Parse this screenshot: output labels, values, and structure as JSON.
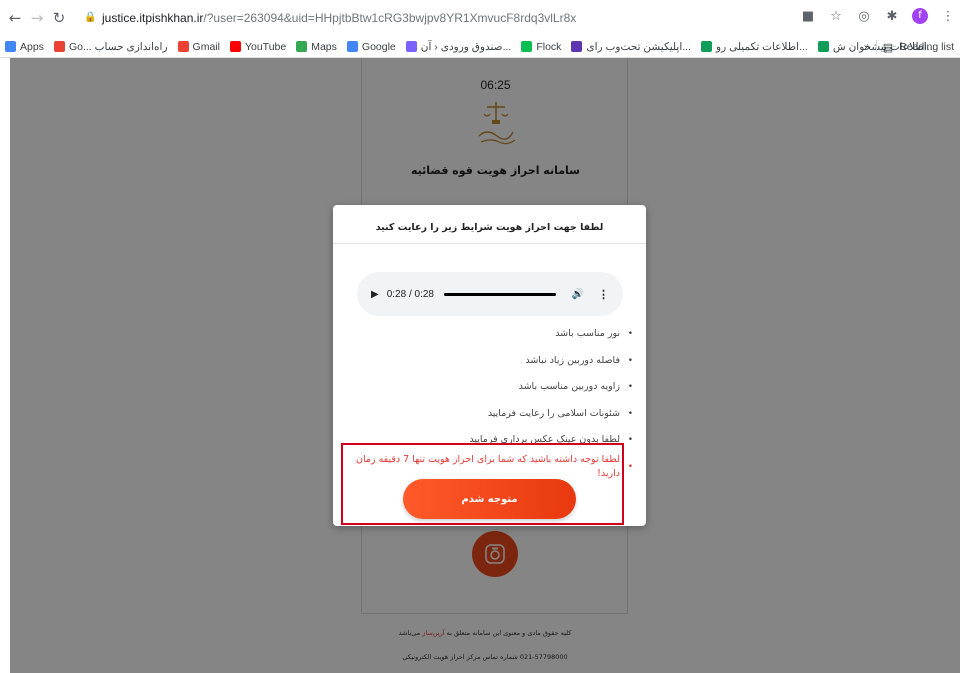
{
  "browser": {
    "url_host": "justice.itpishkhan.ir",
    "url_path": "/?user=263094&uid=HHpjtbBtw1cRG3bwjpv8YR1XmvucF8rdq3vlLr8x",
    "profile_initial": "f",
    "bookmarks": [
      {
        "label": "Apps",
        "icon": "apps-grid-icon",
        "color": "#4285f4"
      },
      {
        "label": "Go... راه‌اندازی حساب",
        "icon": "gmail-icon",
        "color": "#ea4335"
      },
      {
        "label": "Gmail",
        "icon": "gmail-icon",
        "color": "#ea4335"
      },
      {
        "label": "YouTube",
        "icon": "youtube-icon",
        "color": "#ff0000"
      },
      {
        "label": "Maps",
        "icon": "maps-pin-icon",
        "color": "#34a853"
      },
      {
        "label": "Google",
        "icon": "google-icon",
        "color": "#4285f4"
      },
      {
        "label": "صندوق ورودی ‹ آن...",
        "icon": "pencil-icon",
        "color": "#7b61ff"
      },
      {
        "label": "Flock",
        "icon": "flock-icon",
        "color": "#0abe51"
      },
      {
        "label": "اپلیکیشن تحت‌وب رای...",
        "icon": "app-icon",
        "color": "#5e35b1"
      },
      {
        "label": "اطلاعات تکمیلی رو...",
        "icon": "sheets-icon",
        "color": "#0f9d58"
      },
      {
        "label": "اطلاعات پیشخوان ش...",
        "icon": "sheets-icon",
        "color": "#0f9d58"
      }
    ],
    "more_bookmarks": "»",
    "reading_list": "Reading list"
  },
  "page": {
    "clock": "06:25",
    "title": "سامانه احراز هویت قوه قضائیه",
    "footer_rights_prefix": "کلیه حقوق مادی و معنوی این سامانه متعلق به",
    "footer_brand": "آرین‌ساز",
    "footer_rights_suffix": "می‌باشد",
    "footer_contact": "021-57798000 شماره تماس مرکز احراز هویت الکترونیکی"
  },
  "modal": {
    "title": "لطفا جهت احراز هویت شرایط زیر را رعایت کنید",
    "audio_time": "0:28 / 0:28",
    "audio_progress": 1.0,
    "rules": [
      "نور مناسب باشد",
      "فاصله دوربین زیاد نباشد",
      "زاویه دوربین مناسب باشد",
      "شئونات اسلامی را رعایت فرمایید",
      "لطفا بدون عینک عکس برداری فرمایید"
    ],
    "warning": "لطفا توجه داشته باشید که شما برای احراز هویت تنها 7 دقیقه زمان دارید!",
    "ok_label": "متوجه شدم"
  },
  "colors": {
    "accent": "#f04a1d",
    "warning": "#e53935",
    "highlight": "#d0021b"
  }
}
